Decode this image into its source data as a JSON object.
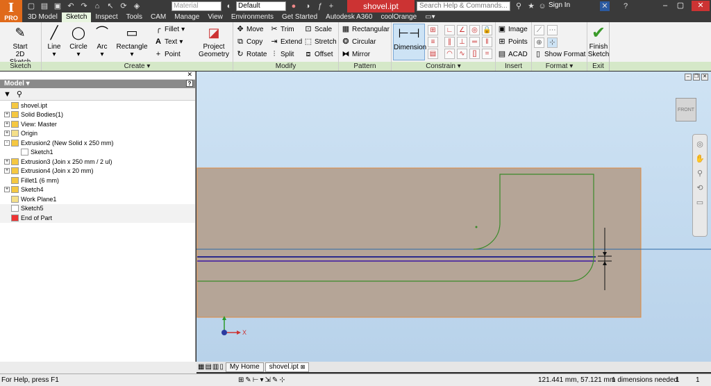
{
  "app": {
    "pro_label": "PRO",
    "doc_title": "shovel.ipt"
  },
  "qat": {
    "material": "Material",
    "appearance": "Default",
    "search_placeholder": "Search Help & Commands...",
    "sign_in": "Sign In"
  },
  "tabs": [
    "3D Model",
    "Sketch",
    "Inspect",
    "Tools",
    "CAM",
    "Manage",
    "View",
    "Environments",
    "Get Started",
    "Autodesk A360",
    "coolOrange"
  ],
  "active_tab": "Sketch",
  "ribbon": {
    "sketch": {
      "start_label_1": "Start",
      "start_label_2": "2D Sketch",
      "footer": "Sketch"
    },
    "create": {
      "line": "Line",
      "circle": "Circle",
      "arc": "Arc",
      "rectangle": "Rectangle",
      "fillet": "Fillet",
      "text": "Text",
      "point": "Point",
      "project_1": "Project",
      "project_2": "Geometry",
      "footer": "Create"
    },
    "modify": {
      "move": "Move",
      "trim": "Trim",
      "scale": "Scale",
      "copy": "Copy",
      "extend": "Extend",
      "stretch": "Stretch",
      "rotate": "Rotate",
      "split": "Split",
      "offset": "Offset",
      "footer": "Modify"
    },
    "pattern": {
      "rectangular": "Rectangular",
      "circular": "Circular",
      "mirror": "Mirror",
      "footer": "Pattern"
    },
    "constrain": {
      "dimension": "Dimension",
      "footer": "Constrain"
    },
    "insert": {
      "image": "Image",
      "points": "Points",
      "acad": "ACAD",
      "footer": "Insert"
    },
    "format": {
      "show_format": "Show Format",
      "footer": "Format"
    },
    "exit": {
      "finish_1": "Finish",
      "finish_2": "Sketch",
      "footer": "Exit"
    }
  },
  "browser": {
    "title": "Model",
    "items": [
      {
        "label": "shovel.ipt",
        "level": 0,
        "exp": ""
      },
      {
        "label": "Solid Bodies(1)",
        "level": 0,
        "exp": "+"
      },
      {
        "label": "View: Master",
        "level": 0,
        "exp": "+"
      },
      {
        "label": "Origin",
        "level": 0,
        "exp": "+"
      },
      {
        "label": "Extrusion2 (New Solid x 250 mm)",
        "level": 0,
        "exp": "-"
      },
      {
        "label": "Sketch1",
        "level": 1,
        "exp": ""
      },
      {
        "label": "Extrusion3 (Join x 250 mm / 2 ul)",
        "level": 0,
        "exp": "+"
      },
      {
        "label": "Extrusion4 (Join x 20 mm)",
        "level": 0,
        "exp": "+"
      },
      {
        "label": "Fillet1 (6 mm)",
        "level": 0,
        "exp": ""
      },
      {
        "label": "Sketch4",
        "level": 0,
        "exp": "+"
      },
      {
        "label": "Work Plane1",
        "level": 0,
        "exp": ""
      },
      {
        "label": "Sketch5",
        "level": 0,
        "exp": ""
      },
      {
        "label": "End of Part",
        "level": 0,
        "exp": ""
      }
    ]
  },
  "viewcube": {
    "face": "FRONT"
  },
  "doc_tabs": [
    "My Home",
    "shovel.ipt"
  ],
  "status": {
    "help": "For Help, press F1",
    "coords": "121.441 mm, 57.121 mm",
    "dims_needed": "1 dimensions needed",
    "count1": "1",
    "count2": "1"
  },
  "colors": {
    "accent": "#7fc241",
    "ribbon_footer": "#d5e8c8",
    "part_face": "#b5a597",
    "part_edge": "#e08a40",
    "sketch_green": "#3a8a2a",
    "doc_title_bg": "#cc3333"
  }
}
